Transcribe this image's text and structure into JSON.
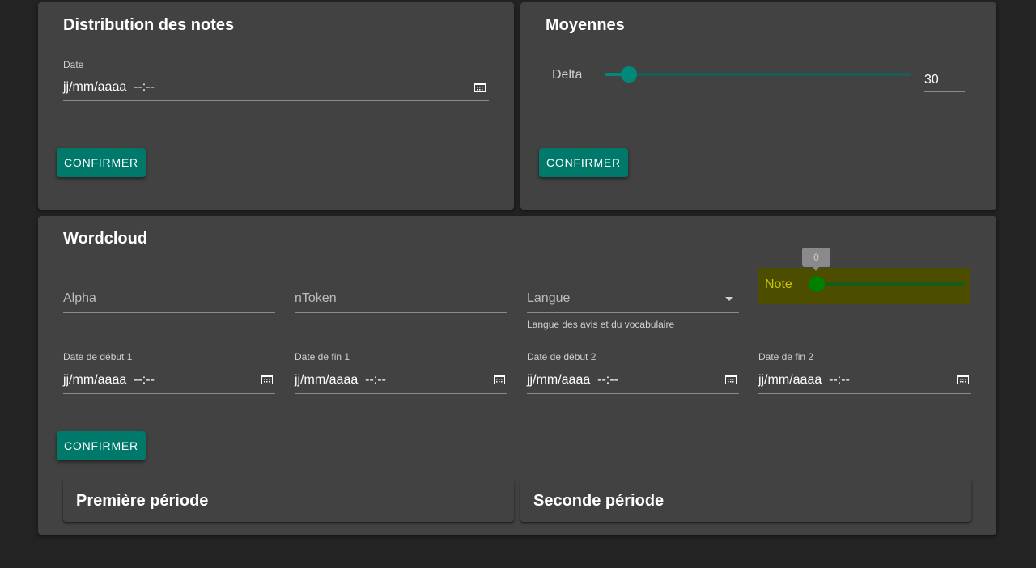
{
  "distribution": {
    "title": "Distribution des notes",
    "date_label": "Date",
    "date_value": "jj/mm/aaaa  --:--",
    "confirm_label": "CONFIRMER",
    "calendar_icon": "calendar-icon"
  },
  "moyennes": {
    "title": "Moyennes",
    "delta_label": "Delta",
    "delta_value": "30",
    "delta_fraction": 0.08,
    "confirm_label": "CONFIRMER"
  },
  "wordcloud": {
    "title": "Wordcloud",
    "alpha_placeholder": "Alpha",
    "ntoken_placeholder": "nToken",
    "langue_placeholder": "Langue",
    "langue_helper": "Langue des avis et du vocabulaire",
    "note_label": "Note",
    "note_value": "0",
    "date_debut_1_label": "Date de début 1",
    "date_fin_1_label": "Date de fin 1",
    "date_debut_2_label": "Date de début 2",
    "date_fin_2_label": "Date de fin 2",
    "date_value": "jj/mm/aaaa  --:--",
    "confirm_label": "CONFIRMER",
    "premiere_periode": "Première période",
    "seconde_periode": "Seconde période"
  },
  "colors": {
    "accent": "#00796b",
    "slider_teal": "#00897b",
    "note_highlight": "#4d4d00",
    "note_text": "#c8c800",
    "note_thumb": "#008000"
  }
}
